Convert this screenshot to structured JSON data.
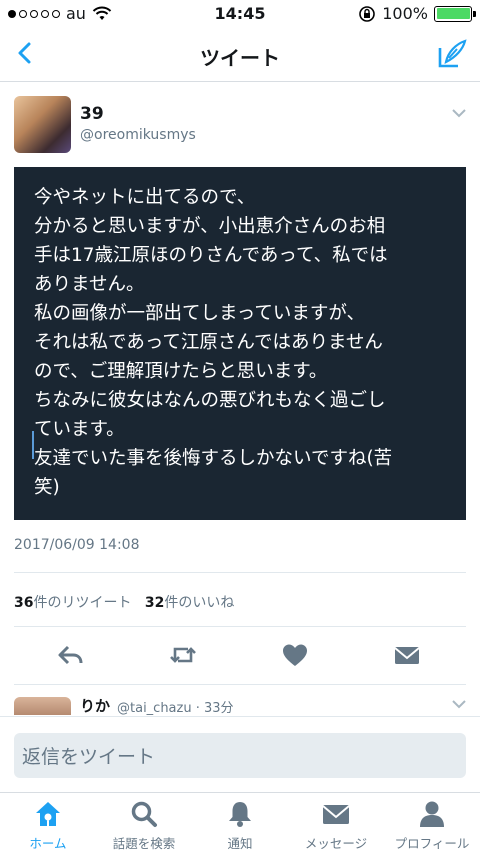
{
  "status_bar": {
    "carrier": "au",
    "time": "14:45",
    "battery": "100%",
    "signal_bars_filled": 1,
    "signal_bars_total": 5
  },
  "nav": {
    "title": "ツイート"
  },
  "tweet": {
    "display_name": "39",
    "handle": "@oreomikusmys",
    "image_text_lines": [
      "今やネットに出てるので、",
      "分かると思いますが、小出恵介さんのお相",
      "手は17歳江原ほのりさんであって、私では",
      "ありません。",
      "私の画像が一部出てしまっていますが、",
      "それは私であって江原さんではありません",
      "ので、ご理解頂けたらと思います。",
      "ちなみに彼女はなんの悪びれもなく過ごし",
      "ています。",
      "友達でいた事を後悔するしかないですね(苦",
      "笑)"
    ],
    "timestamp": "2017/06/09 14:08",
    "retweet_count": "36",
    "retweet_label": "件のリツイート",
    "like_count": "32",
    "like_label": "件のいいね"
  },
  "reply_preview": {
    "name": "りか",
    "handle_time": "@tai_chazu · 33分"
  },
  "reply_input": {
    "placeholder": "返信をツイート"
  },
  "tab_bar": {
    "tabs": [
      {
        "label": "ホーム",
        "icon": "home-icon",
        "active": true
      },
      {
        "label": "話題を検索",
        "icon": "search-icon",
        "active": false
      },
      {
        "label": "通知",
        "icon": "bell-icon",
        "active": false
      },
      {
        "label": "メッセージ",
        "icon": "mail-icon",
        "active": false
      },
      {
        "label": "プロフィール",
        "icon": "person-icon",
        "active": false
      }
    ]
  },
  "colors": {
    "accent": "#1da1f2",
    "image_bg": "#1a2632",
    "secondary_text": "#657786",
    "battery": "#4cd964"
  }
}
